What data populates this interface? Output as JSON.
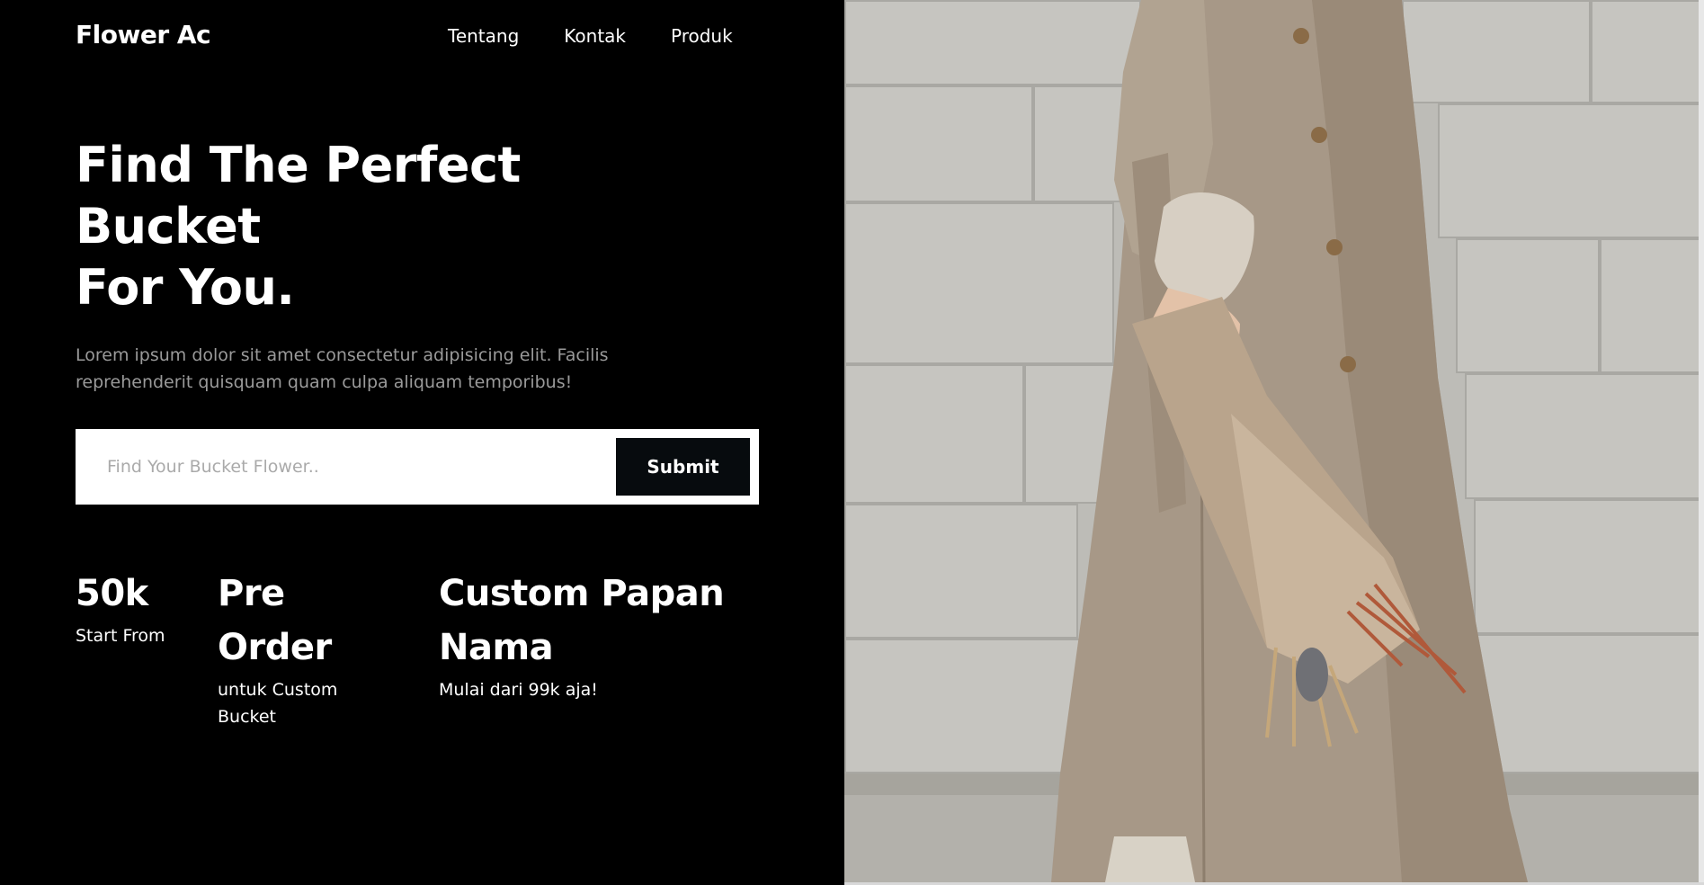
{
  "brand": "Flower Ac",
  "nav": {
    "items": [
      "Tentang",
      "Kontak",
      "Produk"
    ]
  },
  "hero": {
    "title_lines": [
      "Find The Perfect",
      "Bucket",
      "For You."
    ],
    "description": "Lorem ipsum dolor sit amet consectetur adipisicing elit. Facilis reprehenderit quisquam quam culpa aliquam temporibus!"
  },
  "search": {
    "placeholder": "Find Your Bucket Flower..",
    "value": "",
    "submit_label": "Submit"
  },
  "stats": [
    {
      "value": "50k",
      "label": "Start From"
    },
    {
      "value": "Pre Order",
      "label": "untuk Custom Bucket"
    },
    {
      "value": "Custom Papan Nama",
      "label": "Mulai dari 99k aja!"
    }
  ],
  "colors": {
    "background": "#000000",
    "text": "#ffffff",
    "muted_text": "#9a9a9a",
    "button": "#070b0e",
    "coat": "#a79887"
  },
  "icons": []
}
